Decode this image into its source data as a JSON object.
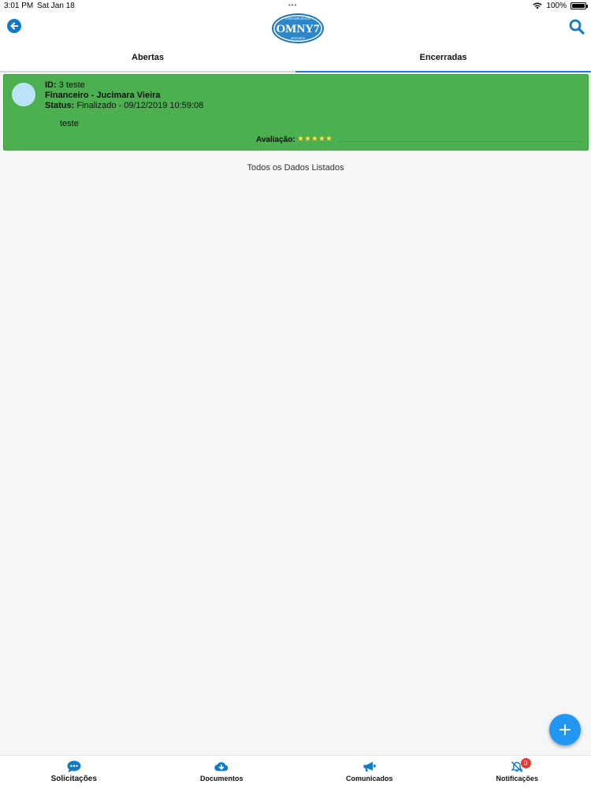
{
  "status_bar": {
    "time": "3:01 PM",
    "date": "Sat Jan 18",
    "battery": "100%",
    "icons": [
      "wifi-icon",
      "battery-icon"
    ]
  },
  "header": {
    "logo": {
      "top_text": "CONTABILIDADE",
      "main_text": "OMNY7",
      "bottom_text": "SEGUROS"
    },
    "back_icon": "back-arrow-icon",
    "search_icon": "search-icon",
    "accent": "#1279c5"
  },
  "tabs": [
    {
      "label": "Abertas",
      "active": false
    },
    {
      "label": "Encerradas",
      "active": true
    }
  ],
  "card": {
    "color": "#4caf50",
    "id_label": "ID:",
    "id_value": "3 teste",
    "department": "Financeiro - Jucimara Vieira",
    "status_label": "Status:",
    "status_value": "Finalizado - 09/12/2019 10:59:08",
    "description": "teste",
    "rating_label": "Avaliação:",
    "rating_stars": "★★★★★",
    "rating_value": 5
  },
  "end_message": "Todos os Dados Listados",
  "fab": {
    "icon": "plus-icon"
  },
  "bottom_nav": {
    "items": [
      {
        "label": "Solicitações",
        "icon": "chat-icon"
      },
      {
        "label": "Documentos",
        "icon": "cloud-download-icon"
      },
      {
        "label": "Comunicados",
        "icon": "megaphone-icon"
      },
      {
        "label": "Notificações",
        "icon": "bell-off-icon",
        "badge": "0"
      }
    ]
  }
}
